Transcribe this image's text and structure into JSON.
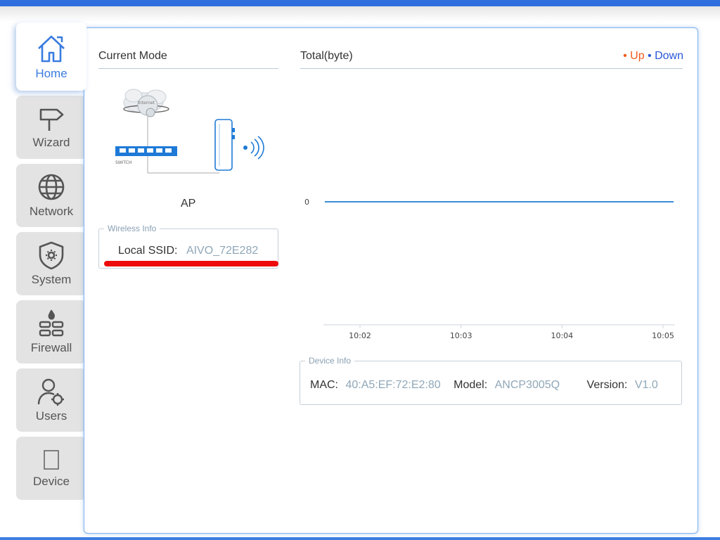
{
  "sidebar": {
    "items": [
      {
        "label": "Home",
        "icon": "home-icon"
      },
      {
        "label": "Wizard",
        "icon": "signpost-icon"
      },
      {
        "label": "Network",
        "icon": "globe-icon"
      },
      {
        "label": "System",
        "icon": "shield-gear-icon"
      },
      {
        "label": "Firewall",
        "icon": "firewall-icon"
      },
      {
        "label": "Users",
        "icon": "user-settings-icon"
      },
      {
        "label": "Device",
        "icon": "device-icon"
      }
    ],
    "active_index": 0
  },
  "current_mode": {
    "title": "Current Mode",
    "diagram_internet": "Internet",
    "diagram_switch": "SWITCH",
    "mode": "AP"
  },
  "wireless_info": {
    "legend": "Wireless Info",
    "ssid_label": "Local SSID:",
    "ssid_value": "AIVO_72E282"
  },
  "traffic": {
    "title": "Total(byte)",
    "legend_up": "• Up",
    "legend_down": "• Down"
  },
  "chart_data": {
    "type": "line",
    "title": "Total(byte)",
    "x": [
      "10:02",
      "10:03",
      "10:04",
      "10:05"
    ],
    "y_ticks": [
      "0"
    ],
    "series": [
      {
        "name": "Up",
        "values": [
          0,
          0,
          0,
          0
        ]
      },
      {
        "name": "Down",
        "values": [
          0,
          0,
          0,
          0
        ]
      }
    ],
    "grid": false,
    "legend_position": "top-right"
  },
  "device_info": {
    "legend": "Device Info",
    "mac_label": "MAC:",
    "mac_value": "40:A5:EF:72:E2:80",
    "model_label": "Model:",
    "model_value": "ANCP3005Q",
    "version_label": "Version:",
    "version_value": "V1.0"
  },
  "colors": {
    "accent": "#3a7ce0",
    "up": "#f05a1a",
    "down": "#2a57d8",
    "top_bar": "#2f6fdd"
  }
}
